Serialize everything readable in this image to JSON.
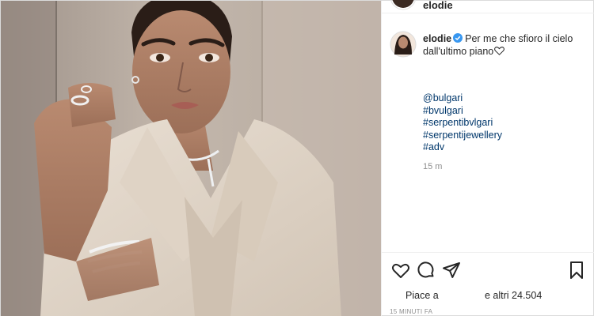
{
  "post": {
    "username": "elodie",
    "caption": "Per me che sfioro il cielo dall'ultimo piano",
    "hashtags": [
      "@bulgari",
      "#bvulgari",
      "#serpentibvlgari",
      "#serpentijewellery",
      "#adv"
    ],
    "caption_time": "15 m",
    "likes_prefix": "Piace a",
    "likes_suffix": "e altri 24.504",
    "timestamp": "15 MINUTI FA"
  },
  "icons": {
    "like": "heart-icon",
    "comment": "comment-icon",
    "share": "paper-plane-icon",
    "save": "bookmark-icon",
    "verified": "verified-badge-icon",
    "caption_heart": "heart-outline-icon"
  },
  "colors": {
    "link": "#00376b",
    "verified": "#3897f0",
    "muted": "#8e8e8e",
    "text": "#262626"
  }
}
